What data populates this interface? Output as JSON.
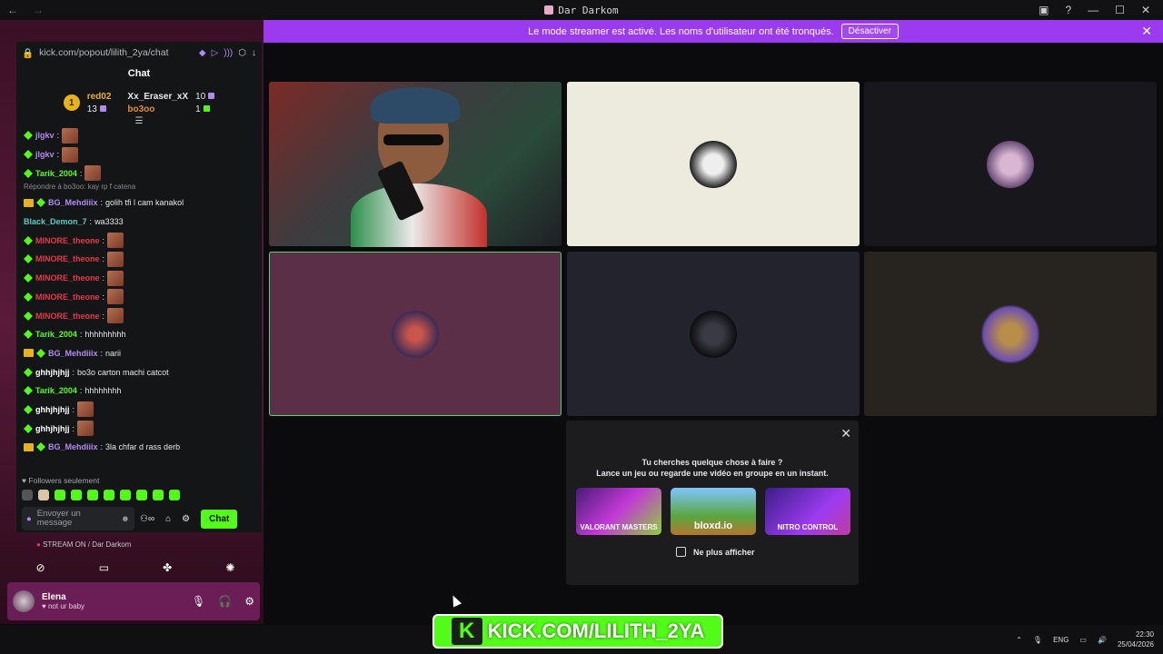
{
  "window": {
    "title": "Dar Darkom",
    "back": "←",
    "forward": "→"
  },
  "banner": {
    "text": "Le mode streamer est activé. Les noms d'utilisateur ont été tronqués.",
    "button": "Désactiver",
    "close": "✕"
  },
  "chat": {
    "url": "kick.com/popout/lilith_2ya/chat",
    "heading": "Chat",
    "leaderboard": {
      "first": {
        "rank": "1",
        "name": "red02",
        "count": "13"
      },
      "second": {
        "name": "Xx_Eraser_xX",
        "count": "10"
      },
      "third": {
        "name": "bo3oo",
        "count": "1"
      }
    },
    "messages": [
      {
        "user": "jlgkv",
        "color": "#b28bf0",
        "text": "",
        "emote": true,
        "crown": false
      },
      {
        "user": "jlgkv",
        "color": "#b28bf0",
        "text": "",
        "emote": true,
        "crown": false
      },
      {
        "user": "Tarik_2004",
        "color": "#53fc18",
        "text": "",
        "emote": true,
        "crown": false
      },
      {
        "user": "BG_Mehdiiix",
        "color": "#b28bf0",
        "text": "golih tfi l cam kanakol",
        "emote": false,
        "crown": true,
        "reply": "Répondre à bo3oo: kay rp f catena"
      },
      {
        "user": "Black_Demon_7",
        "color": "#53d1c4",
        "text": "wa3333",
        "emote": false,
        "crown": false,
        "nobadge": true
      },
      {
        "user": "MINORE_theone",
        "color": "#e8364a",
        "text": "",
        "emote": true,
        "crown": false
      },
      {
        "user": "MINORE_theone",
        "color": "#e8364a",
        "text": "",
        "emote": true,
        "crown": false
      },
      {
        "user": "MINORE_theone",
        "color": "#e8364a",
        "text": "",
        "emote": true,
        "crown": false
      },
      {
        "user": "MINORE_theone",
        "color": "#e8364a",
        "text": "",
        "emote": true,
        "crown": false
      },
      {
        "user": "MINORE_theone",
        "color": "#e8364a",
        "text": "",
        "emote": true,
        "crown": false
      },
      {
        "user": "Tarik_2004",
        "color": "#53fc18",
        "text": "hhhhhhhhh",
        "emote": false,
        "crown": false
      },
      {
        "user": "BG_Mehdiiix",
        "color": "#b28bf0",
        "text": "narii",
        "emote": false,
        "crown": true
      },
      {
        "user": "ghhjhjhjj",
        "color": "#ffffff",
        "text": "bo3o carton machi catcot",
        "emote": false,
        "crown": false
      },
      {
        "user": "Tarik_2004",
        "color": "#53fc18",
        "text": "hhhhhhhh",
        "emote": false,
        "crown": false
      },
      {
        "user": "ghhjhjhjj",
        "color": "#ffffff",
        "text": "",
        "emote": true,
        "crown": false
      },
      {
        "user": "ghhjhjhjj",
        "color": "#ffffff",
        "text": "",
        "emote": true,
        "crown": false
      },
      {
        "user": "BG_Mehdiiix",
        "color": "#b28bf0",
        "text": "3la chfar d rass derb",
        "emote": false,
        "crown": true
      }
    ],
    "followers_only": "Followers seulement",
    "input_placeholder": "Envoyer un message",
    "send": "Chat"
  },
  "voice": {
    "status": "STREAM ON / Dar Darkom"
  },
  "user": {
    "name": "Elena",
    "status": "not ur baby"
  },
  "activity": {
    "line1": "Tu cherches quelque chose à faire ?",
    "line2": "Lance un jeu ou regarde une vidéo en groupe en un instant.",
    "games": [
      "VALORANT MASTERS",
      "bloxd.io",
      "NITRO CONTROL"
    ],
    "dont_show": "Ne plus afficher"
  },
  "taskbar": {
    "lang": "ENG",
    "time": "22:30",
    "date": "25/04/2026"
  },
  "watermark": {
    "text": "KICK.COM/LILITH_2YA"
  },
  "colors": {
    "kick_green": "#53fc18",
    "banner_purple": "#9b3bf0"
  }
}
